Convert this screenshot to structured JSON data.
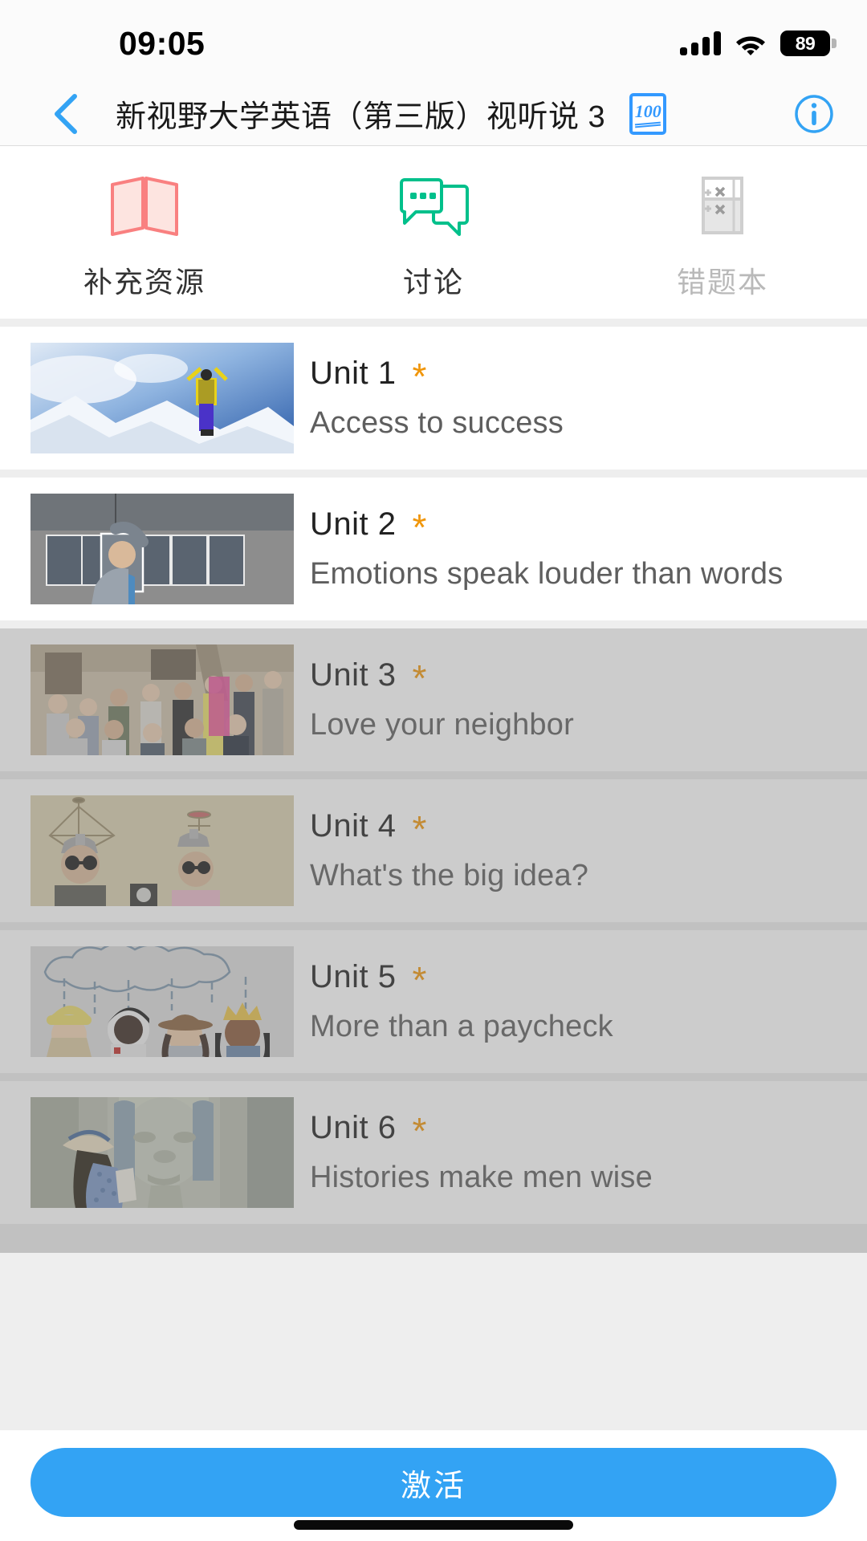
{
  "status_bar": {
    "time": "09:05",
    "battery_level": "89",
    "signal_icon": "cellular-signal-icon",
    "wifi_icon": "wifi-icon",
    "battery_icon": "battery-icon"
  },
  "nav_bar": {
    "back_icon": "chevron-left-icon",
    "title": "新视野大学英语（第三版）视听说 3",
    "score_badge": {
      "icon": "score-100-icon",
      "value": "100"
    },
    "info_icon": "info-circle-icon"
  },
  "tabs": [
    {
      "label": "补充资源",
      "icon": "map-book-icon",
      "color": "#f98080",
      "disabled": false
    },
    {
      "label": "讨论",
      "icon": "chat-bubble-icon",
      "color": "#00c08b",
      "disabled": false
    },
    {
      "label": "错题本",
      "icon": "wrong-question-notebook-icon",
      "color": "#cccccc",
      "disabled": true
    }
  ],
  "units": [
    {
      "number": "Unit 1",
      "marker": "*",
      "title": "Access to success",
      "thumb": "mountain-climber-photo",
      "locked": false
    },
    {
      "number": "Unit 2",
      "marker": "*",
      "title": "Emotions speak louder than words",
      "thumb": "man-portraits-photo",
      "locked": false
    },
    {
      "number": "Unit 3",
      "marker": "*",
      "title": "Love your neighbor",
      "thumb": "volunteer-group-photo",
      "locked": true
    },
    {
      "number": "Unit 4",
      "marker": "*",
      "title": "What's the big idea?",
      "thumb": "thinking-caps-photo",
      "locked": true
    },
    {
      "number": "Unit 5",
      "marker": "*",
      "title": "More than a paycheck",
      "thumb": "children-costumes-photo",
      "locked": true
    },
    {
      "number": "Unit 6",
      "marker": "*",
      "title": "Histories make men wise",
      "thumb": "egypt-statue-photo",
      "locked": true
    }
  ],
  "footer": {
    "activate_label": "激活",
    "accent_color": "#33a3f4"
  }
}
